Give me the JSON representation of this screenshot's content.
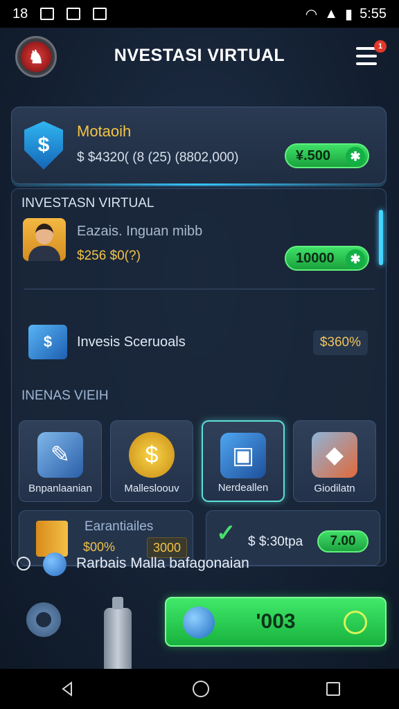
{
  "status_bar": {
    "time_left": "18",
    "time_right": "5:55",
    "icons": [
      "gallery-icon",
      "photo-icon",
      "image-icon",
      "wifi-icon",
      "signal-icon",
      "battery-icon"
    ]
  },
  "header": {
    "title": "NVESTASI VIRTUAL",
    "menu_badge": "1"
  },
  "account": {
    "name": "Motaoih",
    "balance": "$ $4320( (8 (25) (8802,000)",
    "pill_value": "¥.500",
    "pill_icon": "✱"
  },
  "section1": {
    "title": "INVESTASN VIRTUAL",
    "user_name": "Eazais. Inguan mibb",
    "user_amount": "$256 $0(?)",
    "user_pill": "10000",
    "service_name": "Invesis Sceruoals",
    "service_value": "$360%"
  },
  "section2": {
    "title": "INENAS VIEIH",
    "tiles": [
      {
        "label": "Bnpanlaanian",
        "icon": "document-icon"
      },
      {
        "label": "Mallesloouv",
        "icon": "coins-icon"
      },
      {
        "label": "Nerdeallen",
        "icon": "box-icon"
      },
      {
        "label": "Giodilatn",
        "icon": "chart-icon"
      }
    ],
    "mini_left": {
      "title": "Earantiailes",
      "amount": "$00%",
      "badge": "3000"
    },
    "mini_right": {
      "amount": "$ $:30tpa",
      "pill": "7.00"
    }
  },
  "footer": {
    "text": "Rarbais Malla bafagonaian",
    "cta_label": "'003"
  },
  "colors": {
    "accent_green": "#3ee067",
    "accent_gold": "#f5c542",
    "accent_cyan": "#45d4ff"
  }
}
